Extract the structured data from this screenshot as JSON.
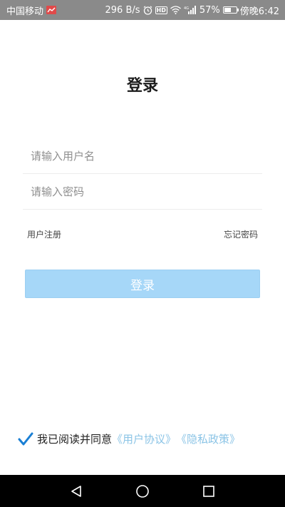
{
  "status_bar": {
    "carrier": "中国移动",
    "network_speed": "296 B/s",
    "hd_label": "HD",
    "signal_label": "4G",
    "battery_percent": "57%",
    "battery_level": 0.57,
    "time": "傍晚6:42"
  },
  "login": {
    "title": "登录",
    "username_placeholder": "请输入用户名",
    "password_placeholder": "请输入密码",
    "register_link": "用户注册",
    "forgot_password_link": "忘记密码",
    "submit_label": "登录"
  },
  "agreement": {
    "checked": true,
    "prefix": "我已阅读并同意",
    "user_agreement": "《用户协议》",
    "privacy_policy": "《隐私政策》"
  },
  "colors": {
    "accent": "#a6d7f8",
    "link": "#8bc4e6",
    "check": "#1a7fd4"
  }
}
